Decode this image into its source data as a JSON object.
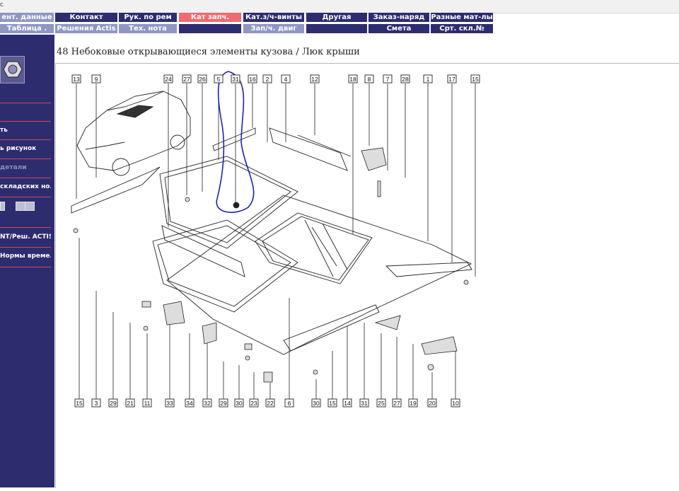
{
  "top_strip_mark": "с",
  "tabs_row1": [
    {
      "label": "ент. данные",
      "style": "light"
    },
    {
      "label": "Контакт",
      "style": "dark"
    },
    {
      "label": "Рук. по рем",
      "style": "dark"
    },
    {
      "label": "Кат запч.",
      "style": "active"
    },
    {
      "label": "Кат.з/ч-винты",
      "style": "dark"
    },
    {
      "label": "Другая",
      "style": "dark"
    },
    {
      "label": "Заказ-наряд",
      "style": "dark"
    },
    {
      "label": "Разные мат-лы",
      "style": "dark"
    }
  ],
  "tabs_row2": [
    {
      "label": "Таблица .",
      "style": "light"
    },
    {
      "label": "Решения Actis",
      "style": "light"
    },
    {
      "label": "Тех. нота",
      "style": "light"
    },
    {
      "label": "",
      "style": "blank"
    },
    {
      "label": "Зап/ч. двиг",
      "style": "light"
    },
    {
      "label": "",
      "style": "blank"
    },
    {
      "label": "Смета",
      "style": "dark"
    },
    {
      "label": "Срт. скл.№",
      "style": "dark"
    }
  ],
  "sidebar": {
    "items": [
      {
        "label": "ть",
        "disabled": false
      },
      {
        "label": "ь рисунок",
        "disabled": false
      },
      {
        "label": "детали",
        "disabled": true
      },
      {
        "label": "складских но...",
        "disabled": false
      },
      {
        "label": "NT/Реш. ACTIS",
        "disabled": false
      },
      {
        "label": "Нормы време...",
        "disabled": false
      }
    ]
  },
  "page_title": "48 Небоковые открывающиеся элементы кузова / Люк крыши",
  "diagram": {
    "top_callouts": [
      "13",
      "9",
      "24",
      "27",
      "26",
      "5",
      "31",
      "16",
      "2",
      "4",
      "12",
      "18",
      "8",
      "7",
      "28",
      "1",
      "17",
      "15"
    ],
    "bottom_callouts": [
      "15",
      "3",
      "29",
      "21",
      "11",
      "33",
      "34",
      "32",
      "29",
      "30",
      "23",
      "22",
      "6",
      "30",
      "15",
      "14",
      "31",
      "25",
      "27",
      "19",
      "20",
      "10"
    ],
    "colors": {
      "line": "#222222",
      "annotation": "#1a24b8"
    }
  }
}
